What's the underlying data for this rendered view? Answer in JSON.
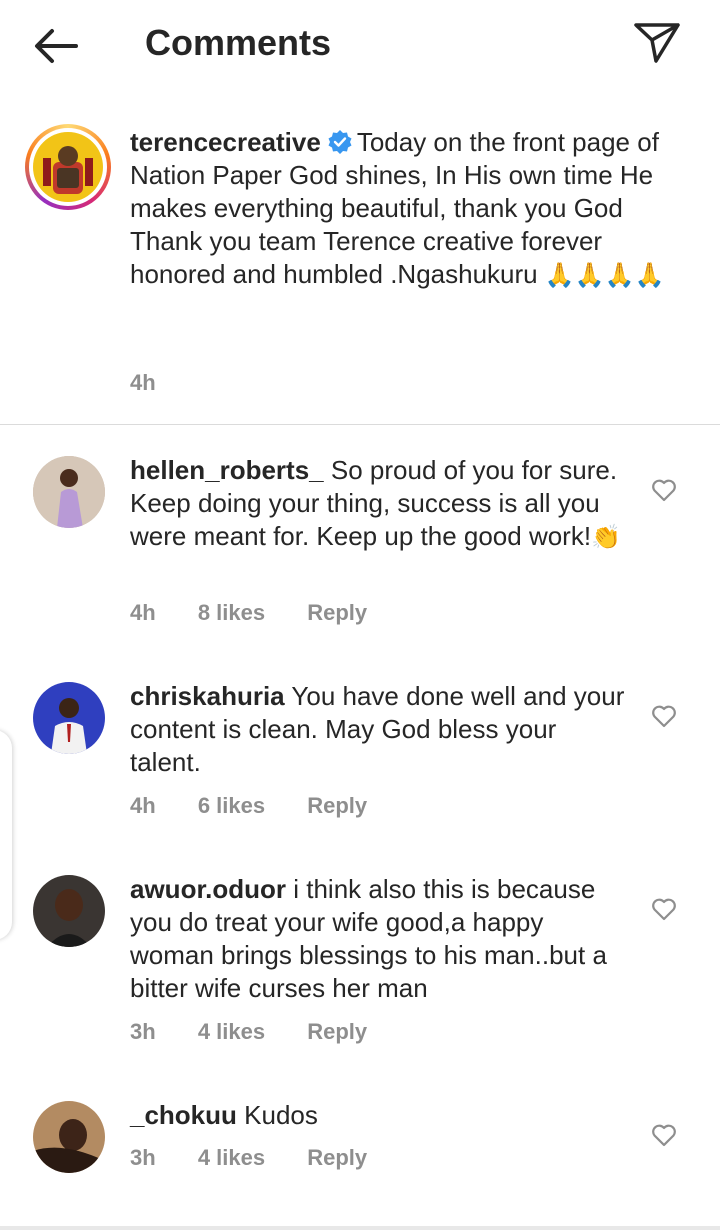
{
  "header": {
    "title": "Comments",
    "back_icon": "arrow-left-icon",
    "send_icon": "paper-plane-icon"
  },
  "caption": {
    "username": "terencecreative",
    "verified": true,
    "text_line1": "Today on the front page of Nation Paper God shines, In His own time He makes everything beautiful, thank you God",
    "text_line2": "Thank you team Terence creative forever honored and humbled .Ngashukuru",
    "emoji": "🙏🙏🙏🙏",
    "time": "4h"
  },
  "comments": [
    {
      "username": "hellen_roberts_",
      "text": "So proud of you for sure. Keep doing your thing, success is all you were meant for. Keep up the good work!",
      "emoji": "👏",
      "time": "4h",
      "likes": "8 likes",
      "reply": "Reply"
    },
    {
      "username": "chriskahuria",
      "text": "You have done well and your content is clean. May God bless your talent.",
      "emoji": "",
      "time": "4h",
      "likes": "6 likes",
      "reply": "Reply"
    },
    {
      "username": "awuor.oduor",
      "text": "i think also this is because you do treat your wife good,a happy woman brings blessings to his man..but a bitter wife curses her man",
      "emoji": "",
      "time": "3h",
      "likes": "4 likes",
      "reply": "Reply"
    },
    {
      "username": "_chokuu",
      "text": "Kudos",
      "emoji": "",
      "time": "3h",
      "likes": "4 likes",
      "reply": "Reply"
    }
  ],
  "colors": {
    "text": "#262626",
    "secondary": "#8e8e8e",
    "verified_blue": "#3897f0",
    "divider": "#dbdbdb"
  }
}
